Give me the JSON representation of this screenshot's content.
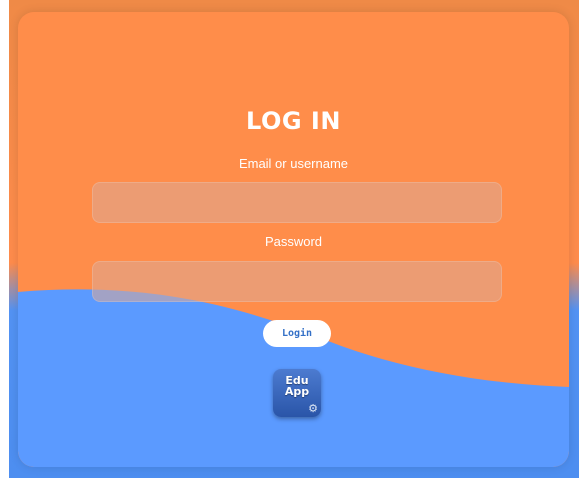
{
  "form": {
    "title": "LOG IN",
    "email_label": "Email or username",
    "email_value": "",
    "password_label": "Password",
    "password_value": "",
    "login_label": "Login"
  },
  "logo": {
    "text_top": "Edu",
    "text_bottom": "App",
    "gear_icon": "gear-icon"
  },
  "colors": {
    "card_orange": "#ff8d4a",
    "card_blue": "#5b9aff",
    "button_text": "#3470c7",
    "input_fill": "#e0a68c"
  }
}
